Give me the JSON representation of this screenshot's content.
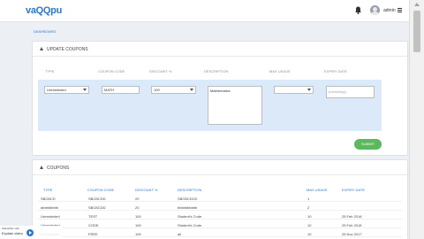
{
  "header": {
    "logo": "vaQQpu",
    "admin_name": "admin"
  },
  "breadcrumb": "DASHBOARD",
  "update_panel": {
    "title": "UPDATE COUPONS",
    "columns": [
      "TYPE",
      "COUPON CODE",
      "DISCOUNT %",
      "DESCRIPTION",
      "MAX USAGE",
      "EXPIRY DATE"
    ],
    "form": {
      "type_value": "Unrestricted",
      "coupon_code_value": "MATH",
      "discount_value": "100",
      "description_value": "Mathematics",
      "max_usage_value": "",
      "expiry_placeholder": "(mm/dd/yy)"
    },
    "submit_label": "SUBMIT"
  },
  "coupons_panel": {
    "title": "COUPONS",
    "columns": [
      "TYPE",
      "COUPON CODE",
      "DISCOUNT %",
      "DESCRIPTION",
      "Max Usage",
      "EXPIRY DATE"
    ],
    "rows": [
      [
        "SBCBCD",
        "SBCBCDD",
        "20",
        "SBCBCDCD",
        "1",
        ""
      ],
      [
        "abbbbbbbb",
        "SBCBCDD",
        "20",
        "bbbbbbbbbb",
        "2",
        ""
      ],
      [
        "Unrestricted",
        "TEST",
        "100",
        "Student's Code",
        "10",
        "25 Feb 2018"
      ],
      [
        "Unrestricted",
        "CODE",
        "100",
        "Student's Code",
        "10",
        "25 Feb 2018"
      ],
      [
        "Unrestricted",
        "FREE",
        "100",
        "all",
        "10",
        "25 Nov 2017"
      ]
    ]
  },
  "overlay": {
    "line1": "Subscribe now",
    "line2": "Explain video"
  }
}
